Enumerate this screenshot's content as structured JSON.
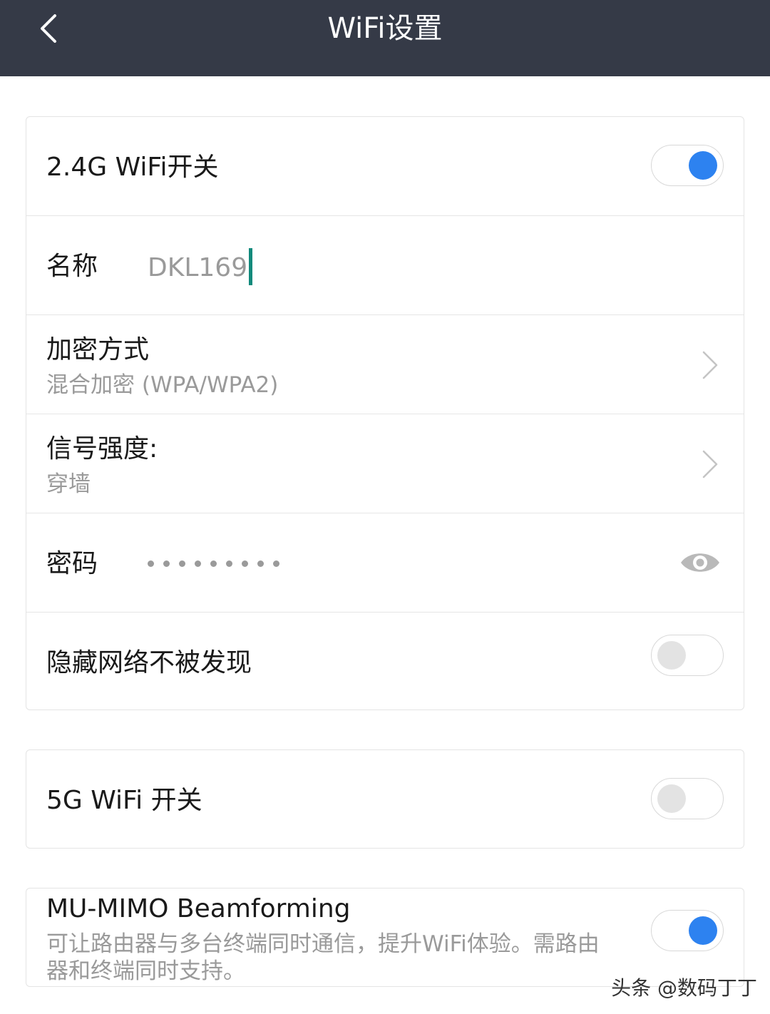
{
  "header": {
    "title": "WiFi设置",
    "back_icon": "chevron-left-icon"
  },
  "card_24g": {
    "switch_label": "2.4G WiFi开关",
    "switch_on": true,
    "name_label": "名称",
    "name_value": "DKL169",
    "encryption_label": "加密方式",
    "encryption_value": "混合加密 (WPA/WPA2)",
    "signal_label": "信号强度:",
    "signal_value": "穿墙",
    "password_label": "密码",
    "password_icon": "eye-icon",
    "hide_label": "隐藏网络不被发现",
    "hide_on": false
  },
  "card_5g": {
    "switch_label": "5G WiFi 开关",
    "switch_on": false
  },
  "card_mumimo": {
    "label": "MU-MIMO Beamforming",
    "description_line1": "可让路由器与多台终端同时通信，提升WiFi体验。需路由",
    "description_line2": "器和终端同时支持。",
    "switch_on": true
  },
  "watermark": {
    "text": "头条 @数码丁丁"
  },
  "colors": {
    "header_bg": "#353a47",
    "toggle_on": "#2d82f0",
    "toggle_off": "#e3e3e3",
    "cursor": "#118a7c"
  }
}
